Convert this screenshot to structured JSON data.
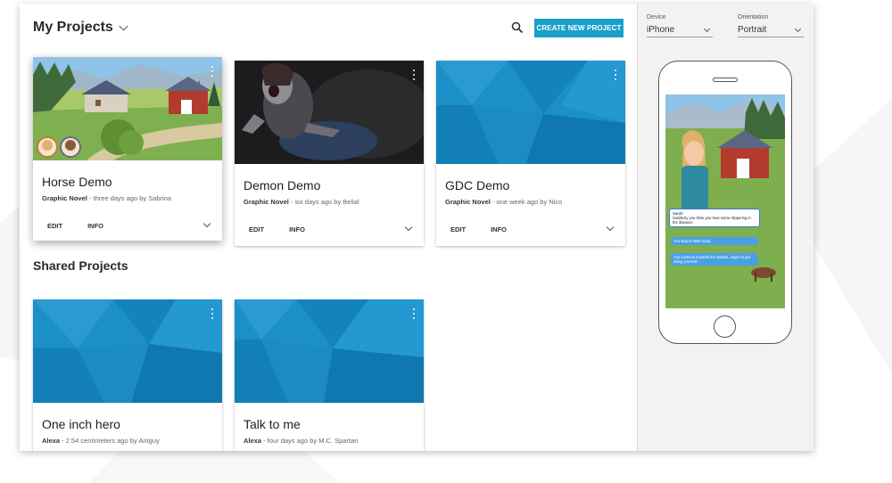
{
  "header": {
    "title": "My Projects",
    "create_button": "CREATE NEW PROJECT"
  },
  "my_projects": [
    {
      "name": "Horse Demo",
      "type": "Graphic Novel",
      "meta": " - three days ago by Sabrina",
      "edit": "EDIT",
      "info": "INFO"
    },
    {
      "name": "Demon Demo",
      "type": "Graphic Novel",
      "meta": " - six days ago by Belial",
      "edit": "EDIT",
      "info": "INFO"
    },
    {
      "name": "GDC Demo",
      "type": "Graphic Novel",
      "meta": " - one week ago by Nico",
      "edit": "EDIT",
      "info": "INFO"
    }
  ],
  "shared_section": {
    "title": "Shared Projects"
  },
  "shared_projects": [
    {
      "name": "One inch hero",
      "type": "Alexa",
      "meta": " - 2.54 centimeters ago by Antguy"
    },
    {
      "name": "Talk to me",
      "type": "Alexa",
      "meta": " - four days ago by M.C. Spartan"
    }
  ],
  "preview": {
    "device_label": "Device",
    "device_value": "iPhone",
    "orientation_label": "Orientation",
    "orientation_value": "Portrait",
    "story": {
      "speaker": "Sarah",
      "line": "Suddenly you think you hear some clippering in the distance.",
      "choice_1": "You stop to listen hard.",
      "choice_2": "You continue towards the stables, eager to get riding yourself."
    }
  },
  "colors": {
    "accent": "#1a9fc9",
    "placeholder_blue": "#1a8fc8"
  }
}
